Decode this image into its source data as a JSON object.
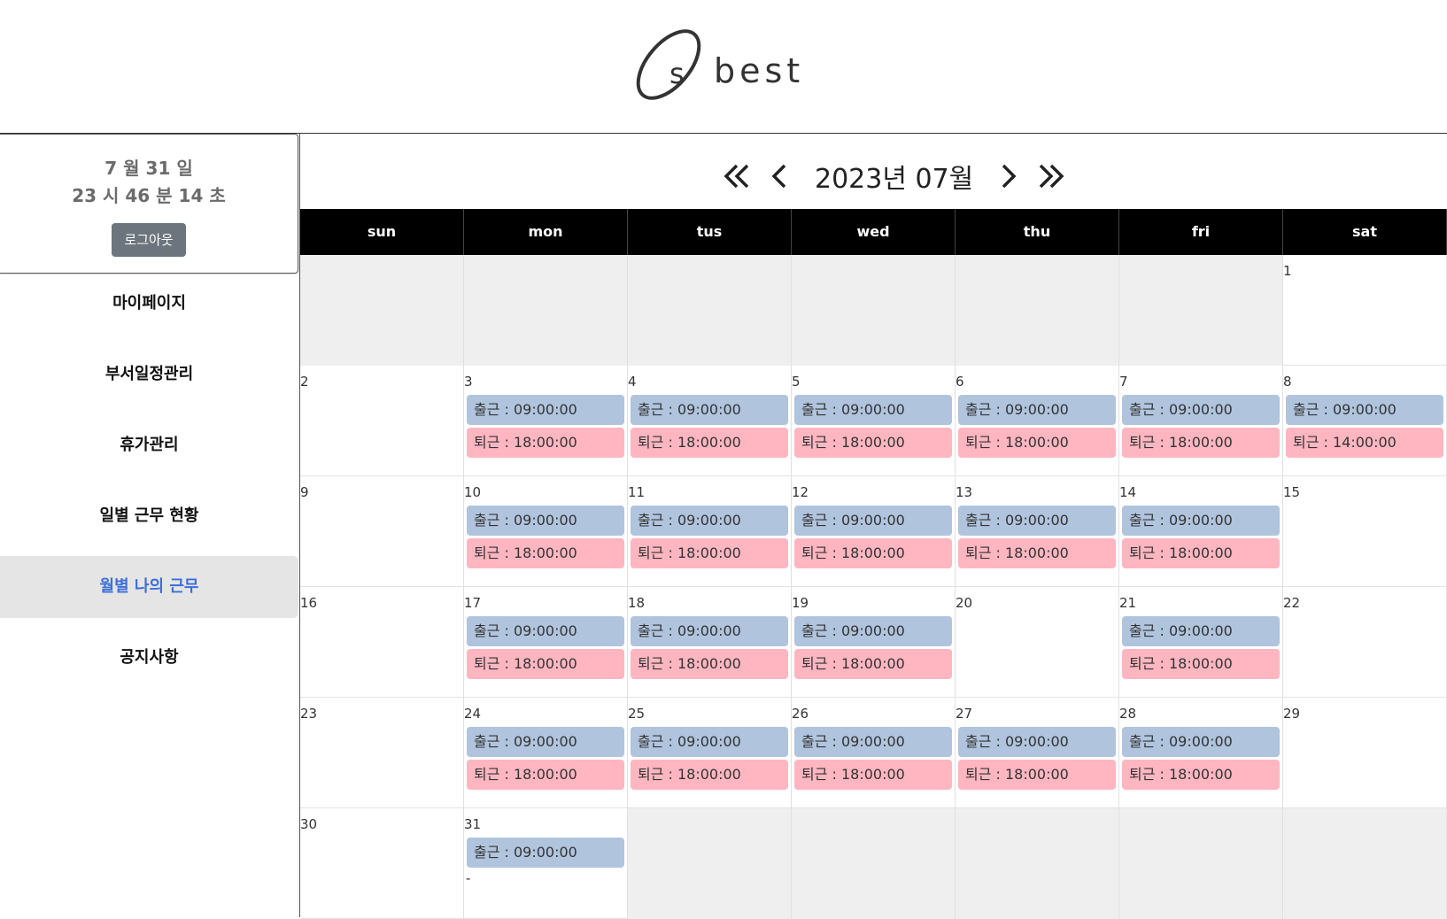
{
  "logo": {
    "text": "best",
    "mark_letter": "s"
  },
  "sidebar": {
    "clock_date": "7 월 31 일",
    "clock_time": "23 시 46 분 14 초",
    "logout_label": "로그아웃",
    "menu": [
      {
        "label": "마이페이지",
        "active": false
      },
      {
        "label": "부서일정관리",
        "active": false
      },
      {
        "label": "휴가관리",
        "active": false
      },
      {
        "label": "일별 근무 현황",
        "active": false
      },
      {
        "label": "월별 나의 근무",
        "active": true
      },
      {
        "label": "공지사항",
        "active": false
      }
    ]
  },
  "calendar": {
    "title": "2023년 07월",
    "nav": {
      "first": "«",
      "prev": "‹",
      "next": "›",
      "last": "»"
    },
    "weekdays": [
      "sun",
      "mon",
      "tus",
      "wed",
      "thu",
      "fri",
      "sat"
    ],
    "in_prefix": "출근 : ",
    "out_prefix": "퇴근 : ",
    "weeks": [
      [
        null,
        null,
        null,
        null,
        null,
        null,
        {
          "day": "1"
        }
      ],
      [
        {
          "day": "2"
        },
        {
          "day": "3",
          "in": "09:00:00",
          "out": "18:00:00"
        },
        {
          "day": "4",
          "in": "09:00:00",
          "out": "18:00:00"
        },
        {
          "day": "5",
          "in": "09:00:00",
          "out": "18:00:00"
        },
        {
          "day": "6",
          "in": "09:00:00",
          "out": "18:00:00"
        },
        {
          "day": "7",
          "in": "09:00:00",
          "out": "18:00:00"
        },
        {
          "day": "8",
          "in": "09:00:00",
          "out": "14:00:00"
        }
      ],
      [
        {
          "day": "9"
        },
        {
          "day": "10",
          "in": "09:00:00",
          "out": "18:00:00"
        },
        {
          "day": "11",
          "in": "09:00:00",
          "out": "18:00:00"
        },
        {
          "day": "12",
          "in": "09:00:00",
          "out": "18:00:00"
        },
        {
          "day": "13",
          "in": "09:00:00",
          "out": "18:00:00"
        },
        {
          "day": "14",
          "in": "09:00:00",
          "out": "18:00:00"
        },
        {
          "day": "15"
        }
      ],
      [
        {
          "day": "16"
        },
        {
          "day": "17",
          "in": "09:00:00",
          "out": "18:00:00"
        },
        {
          "day": "18",
          "in": "09:00:00",
          "out": "18:00:00"
        },
        {
          "day": "19",
          "in": "09:00:00",
          "out": "18:00:00"
        },
        {
          "day": "20"
        },
        {
          "day": "21",
          "in": "09:00:00",
          "out": "18:00:00"
        },
        {
          "day": "22"
        }
      ],
      [
        {
          "day": "23"
        },
        {
          "day": "24",
          "in": "09:00:00",
          "out": "18:00:00"
        },
        {
          "day": "25",
          "in": "09:00:00",
          "out": "18:00:00"
        },
        {
          "day": "26",
          "in": "09:00:00",
          "out": "18:00:00"
        },
        {
          "day": "27",
          "in": "09:00:00",
          "out": "18:00:00"
        },
        {
          "day": "28",
          "in": "09:00:00",
          "out": "18:00:00"
        },
        {
          "day": "29"
        }
      ],
      [
        {
          "day": "30"
        },
        {
          "day": "31",
          "in": "09:00:00",
          "out_missing": "-"
        },
        null,
        null,
        null,
        null,
        null
      ]
    ]
  }
}
